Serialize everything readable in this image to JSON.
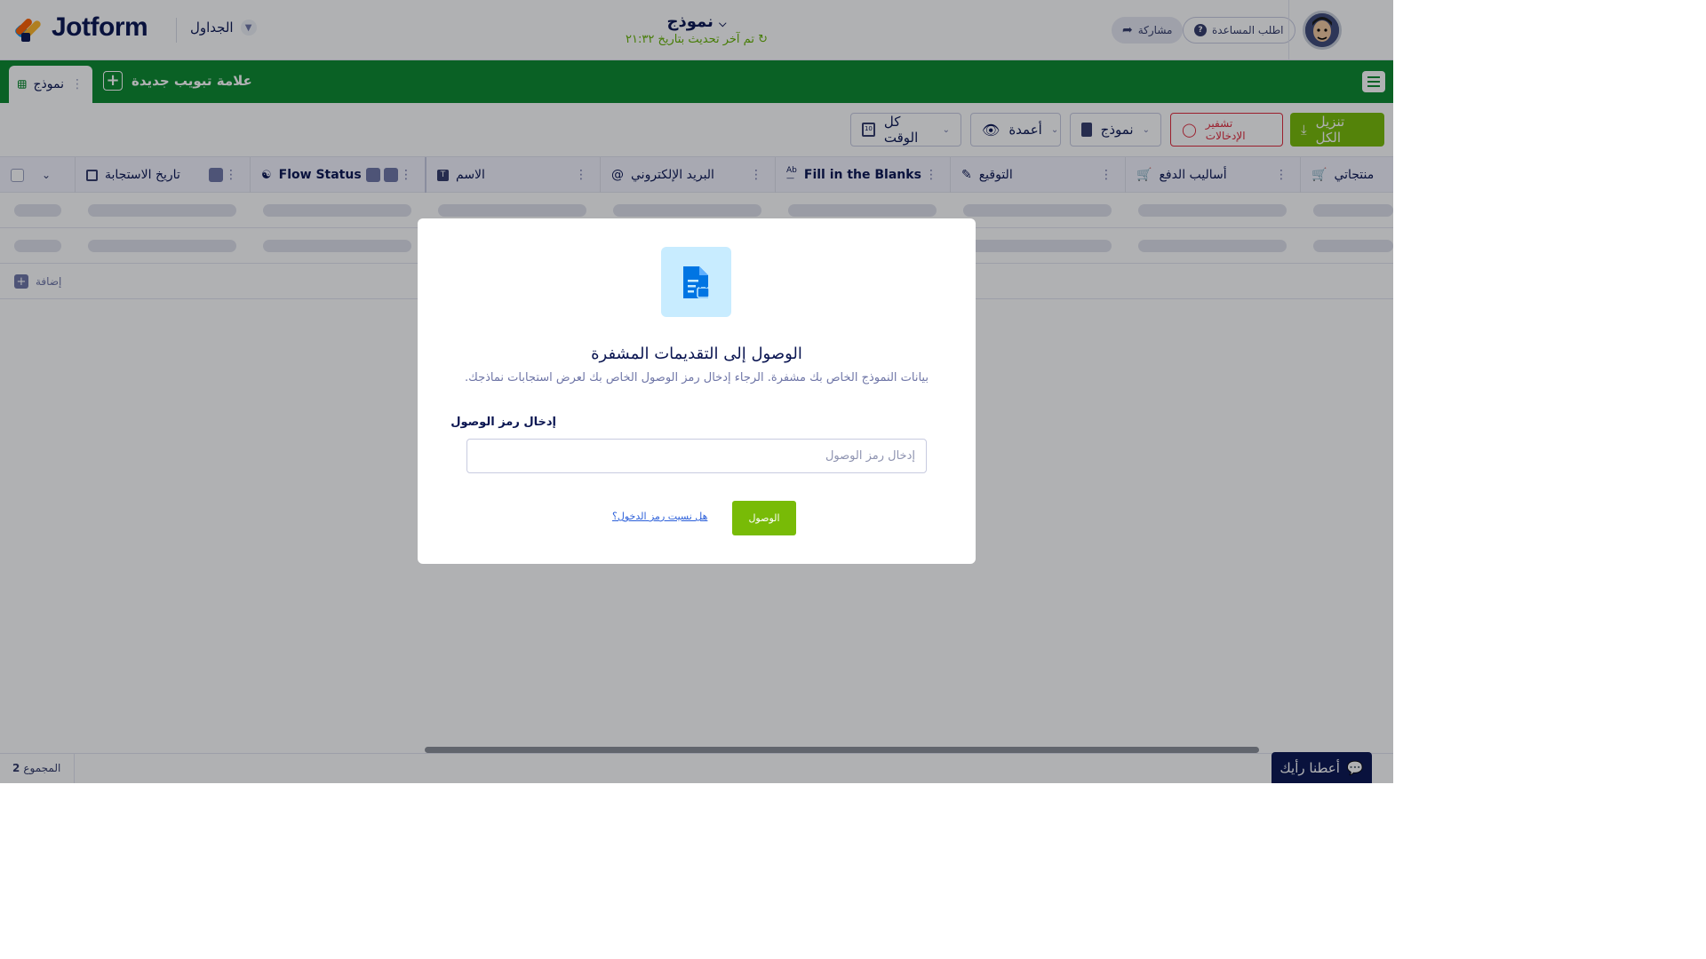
{
  "app": {
    "brand": "Jotform"
  },
  "topbar": {
    "tables_label": "الجداول",
    "form_name": "نموذج",
    "updated_text": "تم آخر تحديث بتاريخ ٢١:٣٢",
    "help_label": "اطلب المساعدة",
    "share_label": "مشاركة"
  },
  "tabs": {
    "active_tab": "نموذج",
    "new_tab_label": "علامة تبويب جديدة"
  },
  "toolbar": {
    "download_all": "تنزيل الكل",
    "encrypt_entries": "تشفير الإدخالات",
    "form_selector": "نموذج",
    "columns": "أعمدة",
    "time_range": "كل الوقت"
  },
  "grid": {
    "columns": [
      {
        "label": "تاريخ الاستجابة",
        "icon": "calendar-icon"
      },
      {
        "label": "Flow Status",
        "icon": "flow-icon"
      },
      {
        "label": "الاسم",
        "icon": "text-icon"
      },
      {
        "label": "البريد الإلكتروني",
        "icon": "at-icon"
      },
      {
        "label": "Fill in the Blanks",
        "icon": "fill-blanks-icon"
      },
      {
        "label": "التوقيع",
        "icon": "signature-icon"
      },
      {
        "label": "أساليب الدفع",
        "icon": "cart-icon"
      },
      {
        "label": "منتجاتي",
        "icon": "cart-icon"
      }
    ],
    "add_row_label": "إضافة",
    "total_label": "المجموع",
    "total_count": "2"
  },
  "feedback": {
    "label": "أعطنا رأيك"
  },
  "modal": {
    "title": "الوصول إلى التقديمات المشفرة",
    "description": ".بيانات النموذج الخاص بك مشفرة. الرجاء إدخال رمز الوصول الخاص بك لعرض استجابات نماذجك",
    "field_label": "إدخال رمز الوصول",
    "field_placeholder": "إدخال رمز الوصول",
    "field_value": "",
    "submit_label": "الوصول",
    "forgot_link": "هل نسيت رمز الدخول؟"
  },
  "colors": {
    "brand_green": "#0b8a2e",
    "button_green": "#78bb07",
    "danger": "#e0283a",
    "navy": "#0a1551"
  }
}
